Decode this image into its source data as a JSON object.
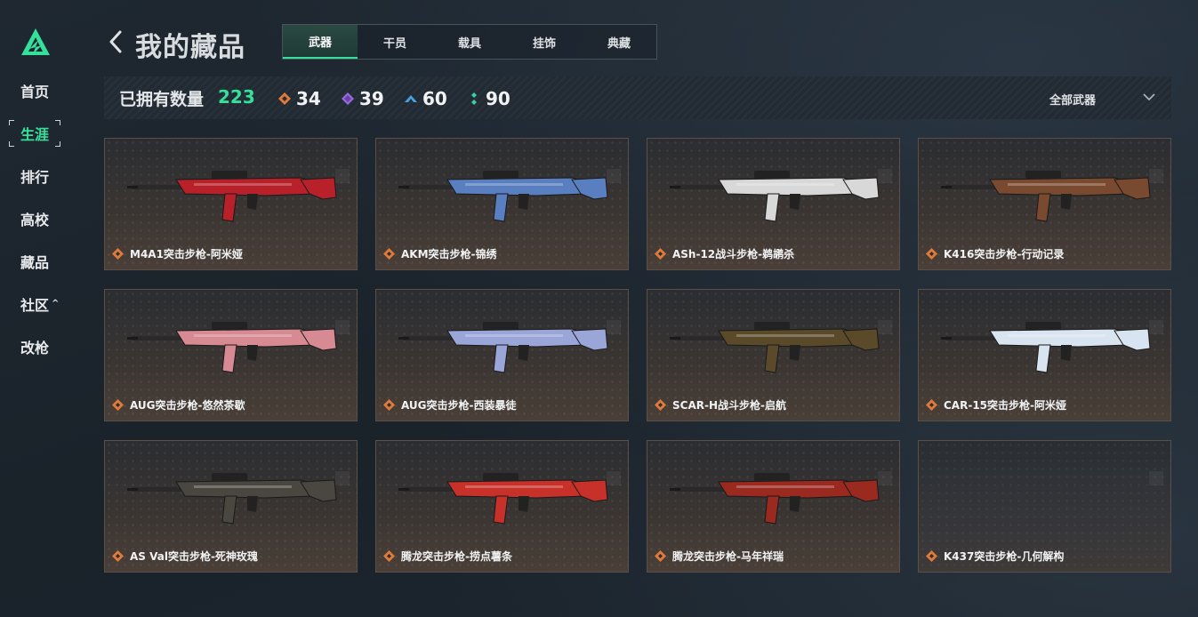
{
  "nav": {
    "items": [
      {
        "label": "首页"
      },
      {
        "label": "生涯"
      },
      {
        "label": "排行"
      },
      {
        "label": "高校"
      },
      {
        "label": "藏品"
      },
      {
        "label": "社区"
      },
      {
        "label": "改枪"
      }
    ],
    "community_caret": "^"
  },
  "header": {
    "title": "我的藏品",
    "tabs": [
      {
        "label": "武器"
      },
      {
        "label": "干员"
      },
      {
        "label": "载具"
      },
      {
        "label": "挂饰"
      },
      {
        "label": "典藏"
      }
    ]
  },
  "stats": {
    "owned_label": "已拥有数量",
    "owned_count": "223",
    "rarities": [
      {
        "icon": "orange-diamond-icon",
        "color": "#e07a3a",
        "count": "34"
      },
      {
        "icon": "purple-diamond-icon",
        "color": "#9a6ad8",
        "count": "39"
      },
      {
        "icon": "blue-chevron-icon",
        "color": "#4aa0e0",
        "count": "60"
      },
      {
        "icon": "green-dots-icon",
        "color": "#3ad0a0",
        "count": "90"
      }
    ],
    "filter_label": "全部武器"
  },
  "colors": {
    "accent": "#35e09a",
    "rarity_gold": "#e07a3a"
  },
  "items": [
    {
      "name": "M4A1突击步枪-阿米娅",
      "tint": "#b8202a"
    },
    {
      "name": "AKM突击步枪-锦绣",
      "tint": "#5a7fc0"
    },
    {
      "name": "ASh-12战斗步枪-鹈鹕杀",
      "tint": "#d8d8d8"
    },
    {
      "name": "K416突击步枪-行动记录",
      "tint": "#7a4a30"
    },
    {
      "name": "AUG突击步枪-悠然茶歇",
      "tint": "#d88a92"
    },
    {
      "name": "AUG突击步枪-西装暴徒",
      "tint": "#9aa6d8"
    },
    {
      "name": "SCAR-H战斗步枪-启航",
      "tint": "#5a4a2a"
    },
    {
      "name": "CAR-15突击步枪-阿米娅",
      "tint": "#d8e4f0"
    },
    {
      "name": "AS Val突击步枪-死神玫瑰",
      "tint": "#4a4640"
    },
    {
      "name": "腾龙突击步枪-捞点薯条",
      "tint": "#c8302a"
    },
    {
      "name": "腾龙突击步枪-马年祥瑞",
      "tint": "#9a2a20"
    },
    {
      "name": "K437突击步枪-几何解构",
      "tint": ""
    }
  ]
}
